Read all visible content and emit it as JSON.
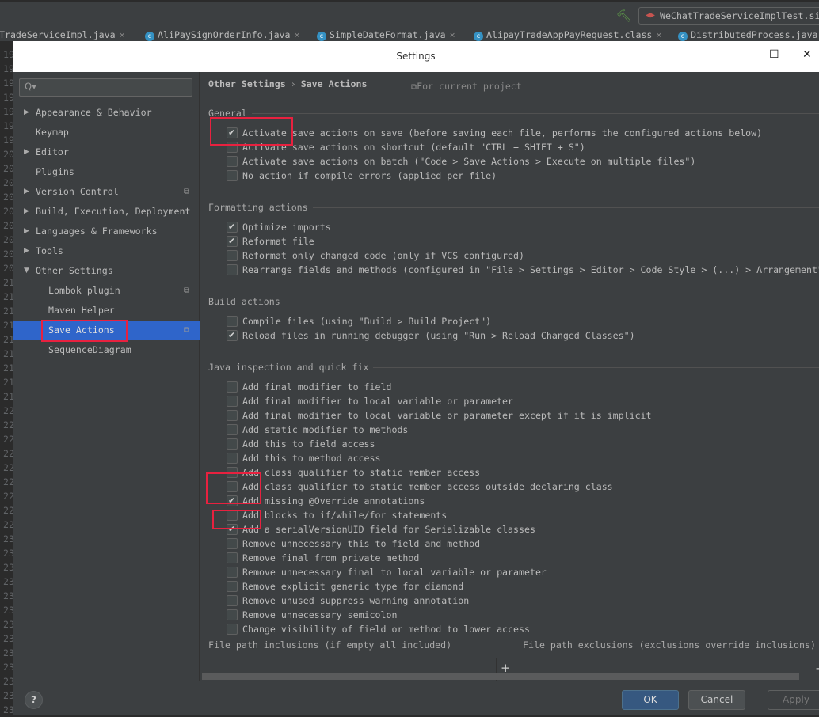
{
  "ide": {
    "run_config": "WeChatTradeServiceImplTest.si",
    "tabs": [
      {
        "label": "yTradeServiceImpl.java",
        "icon": false
      },
      {
        "label": "AliPaySignOrderInfo.java",
        "icon": true
      },
      {
        "label": "SimpleDateFormat.java",
        "icon": true
      },
      {
        "label": "AlipayTradeAppPayRequest.class",
        "icon": true
      },
      {
        "label": "DistributedProcess.java",
        "icon": true
      }
    ],
    "gutter": [
      "19",
      "19",
      "19",
      "19",
      "19",
      "19",
      "19",
      "20",
      "20",
      "20",
      "20",
      "20",
      "20",
      "20",
      "20",
      "20",
      "21",
      "21",
      "21",
      "21",
      "21",
      "21",
      "21",
      "21",
      "21",
      "22",
      "22",
      "22",
      "22",
      "22",
      "22",
      "22",
      "22",
      "22",
      "23",
      "23",
      "23",
      "23",
      "23",
      "23",
      "23",
      "23",
      "23",
      "23",
      "23",
      "23",
      "23"
    ]
  },
  "dialog": {
    "title": "Settings",
    "search_placeholder": "Q▾",
    "sidebar": [
      {
        "label": "Appearance & Behavior",
        "arrow": "▶",
        "indent": 0
      },
      {
        "label": "Keymap",
        "arrow": "",
        "indent": 0
      },
      {
        "label": "Editor",
        "arrow": "▶",
        "indent": 0
      },
      {
        "label": "Plugins",
        "arrow": "",
        "indent": 0
      },
      {
        "label": "Version Control",
        "arrow": "▶",
        "indent": 0,
        "project": true
      },
      {
        "label": "Build, Execution, Deployment",
        "arrow": "▶",
        "indent": 0
      },
      {
        "label": "Languages & Frameworks",
        "arrow": "▶",
        "indent": 0
      },
      {
        "label": "Tools",
        "arrow": "▶",
        "indent": 0
      },
      {
        "label": "Other Settings",
        "arrow": "▼",
        "indent": 0
      },
      {
        "label": "Lombok plugin",
        "arrow": "",
        "indent": 1,
        "project": true
      },
      {
        "label": "Maven Helper",
        "arrow": "",
        "indent": 1
      },
      {
        "label": "Save Actions",
        "arrow": "",
        "indent": 1,
        "project": true,
        "selected": true
      },
      {
        "label": "SequenceDiagram",
        "arrow": "",
        "indent": 1
      }
    ],
    "breadcrumb": {
      "parent": "Other Settings",
      "separator": "›",
      "current": "Save Actions"
    },
    "scope": "For current project",
    "sections": [
      {
        "title": "General",
        "items": [
          {
            "label": "Activate save actions on save (before saving each file, performs the configured actions below)",
            "checked": true
          },
          {
            "label": "Activate save actions on shortcut (default \"CTRL + SHIFT + S\")",
            "checked": false
          },
          {
            "label": "Activate save actions on batch (\"Code > Save Actions > Execute on multiple files\")",
            "checked": false
          },
          {
            "label": "No action if compile errors (applied per file)",
            "checked": false
          }
        ]
      },
      {
        "title": "Formatting actions",
        "items": [
          {
            "label": "Optimize imports",
            "checked": true
          },
          {
            "label": "Reformat file",
            "checked": true
          },
          {
            "label": "Reformat only changed code (only if VCS configured)",
            "checked": false
          },
          {
            "label": "Rearrange fields and methods (configured in \"File > Settings > Editor > Code Style > (...) > Arrangement\")",
            "checked": false
          }
        ]
      },
      {
        "title": "Build actions",
        "items": [
          {
            "label": "Compile files (using \"Build > Build Project\")",
            "checked": false
          },
          {
            "label": "Reload files in running debugger (using \"Run > Reload Changed Classes\")",
            "checked": true
          }
        ]
      },
      {
        "title": "Java inspection and quick fix",
        "items": [
          {
            "label": "Add final modifier to field",
            "checked": false
          },
          {
            "label": "Add final modifier to local variable or parameter",
            "checked": false
          },
          {
            "label": "Add final modifier to local variable or parameter except if it is implicit",
            "checked": false
          },
          {
            "label": "Add static modifier to methods",
            "checked": false
          },
          {
            "label": "Add this to field access",
            "checked": false
          },
          {
            "label": "Add this to method access",
            "checked": false
          },
          {
            "label": "Add class qualifier to static member access",
            "checked": false
          },
          {
            "label": "Add class qualifier to static member access outside declaring class",
            "checked": false
          },
          {
            "label": "Add missing @Override annotations",
            "checked": true
          },
          {
            "label": "Add blocks to if/while/for statements",
            "checked": false
          },
          {
            "label": "Add a serialVersionUID field for Serializable classes",
            "checked": true
          },
          {
            "label": "Remove unnecessary this to field and method",
            "checked": false
          },
          {
            "label": "Remove final from private method",
            "checked": false
          },
          {
            "label": "Remove unnecessary final to local variable or parameter",
            "checked": false
          },
          {
            "label": "Remove explicit generic type for diamond",
            "checked": false
          },
          {
            "label": "Remove unused suppress warning annotation",
            "checked": false
          },
          {
            "label": "Remove unnecessary semicolon",
            "checked": false
          },
          {
            "label": "Change visibility of field or method to lower access",
            "checked": false
          }
        ]
      }
    ],
    "inclusions_label": "File path inclusions (if empty all included)",
    "exclusions_label": "File path exclusions (exclusions override inclusions)",
    "add": "+",
    "remove": "-",
    "help": "?",
    "ok": "OK",
    "cancel": "Cancel",
    "apply": "Apply",
    "highlight_color": "#e8213f",
    "selection_color": "#2f65ca"
  }
}
